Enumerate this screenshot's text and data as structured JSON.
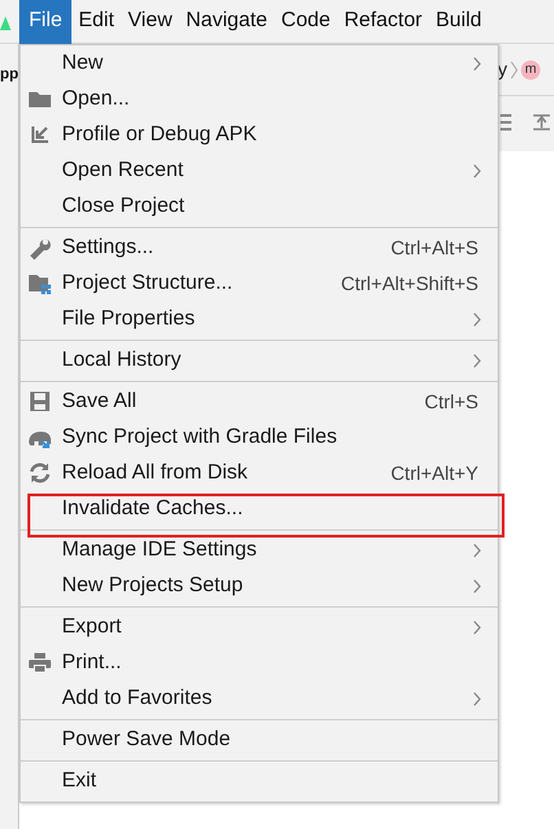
{
  "menu_bar": [
    {
      "label": "File",
      "selected": true
    },
    {
      "label": "Edit",
      "selected": false
    },
    {
      "label": "View",
      "selected": false
    },
    {
      "label": "Navigate",
      "selected": false
    },
    {
      "label": "Code",
      "selected": false
    },
    {
      "label": "Refactor",
      "selected": false
    },
    {
      "label": "Build",
      "selected": false
    }
  ],
  "background": {
    "left_text": "pp",
    "breadcrumb": "y",
    "avatar": "m"
  },
  "menu": [
    {
      "kind": "item",
      "label": "New",
      "submenu": true,
      "highlighted": false
    },
    {
      "kind": "item",
      "label": "Open...",
      "submenu": false,
      "highlighted": false
    },
    {
      "kind": "item",
      "label": "Profile or Debug APK",
      "submenu": false,
      "highlighted": false
    },
    {
      "kind": "item",
      "label": "Open Recent",
      "submenu": true,
      "highlighted": false
    },
    {
      "kind": "item",
      "label": "Close Project",
      "submenu": false,
      "highlighted": false
    },
    {
      "kind": "separator"
    },
    {
      "kind": "item",
      "label": "Settings...",
      "shortcut": "Ctrl+Alt+S",
      "submenu": false,
      "highlighted": false
    },
    {
      "kind": "item",
      "label": "Project Structure...",
      "shortcut": "Ctrl+Alt+Shift+S",
      "submenu": false,
      "highlighted": false
    },
    {
      "kind": "item",
      "label": "File Properties",
      "submenu": true,
      "highlighted": false
    },
    {
      "kind": "separator"
    },
    {
      "kind": "item",
      "label": "Local History",
      "submenu": true,
      "highlighted": false
    },
    {
      "kind": "separator"
    },
    {
      "kind": "item",
      "label": "Save All",
      "shortcut": "Ctrl+S",
      "submenu": false,
      "highlighted": false
    },
    {
      "kind": "item",
      "label": "Sync Project with Gradle Files",
      "submenu": false,
      "highlighted": false
    },
    {
      "kind": "item",
      "label": "Reload All from Disk",
      "shortcut": "Ctrl+Alt+Y",
      "submenu": false,
      "highlighted": false
    },
    {
      "kind": "item",
      "label": "Invalidate Caches...",
      "submenu": false,
      "highlighted": true
    },
    {
      "kind": "separator"
    },
    {
      "kind": "item",
      "label": "Manage IDE Settings",
      "submenu": true,
      "highlighted": false
    },
    {
      "kind": "item",
      "label": "New Projects Setup",
      "submenu": true,
      "highlighted": false
    },
    {
      "kind": "separator"
    },
    {
      "kind": "item",
      "label": "Export",
      "submenu": true,
      "highlighted": false
    },
    {
      "kind": "item",
      "label": "Print...",
      "submenu": false,
      "highlighted": false
    },
    {
      "kind": "item",
      "label": "Add to Favorites",
      "submenu": true,
      "highlighted": false
    },
    {
      "kind": "separator"
    },
    {
      "kind": "item",
      "label": "Power Save Mode",
      "submenu": false,
      "highlighted": false
    },
    {
      "kind": "separator"
    },
    {
      "kind": "item",
      "label": "Exit",
      "submenu": false,
      "highlighted": false
    }
  ]
}
